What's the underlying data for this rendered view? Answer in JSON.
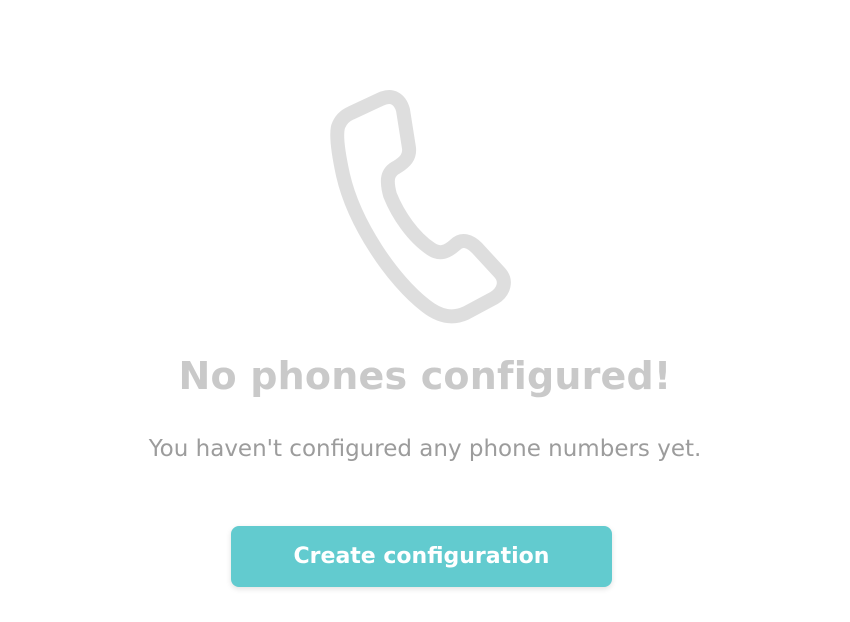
{
  "empty_state": {
    "icon": "phone-handset-icon",
    "icon_color": "#dedede",
    "title": "No phones configured!",
    "subtitle": "You haven't configured any phone numbers yet.",
    "button_label": "Create configuration",
    "button_color": "#62cbcf"
  }
}
